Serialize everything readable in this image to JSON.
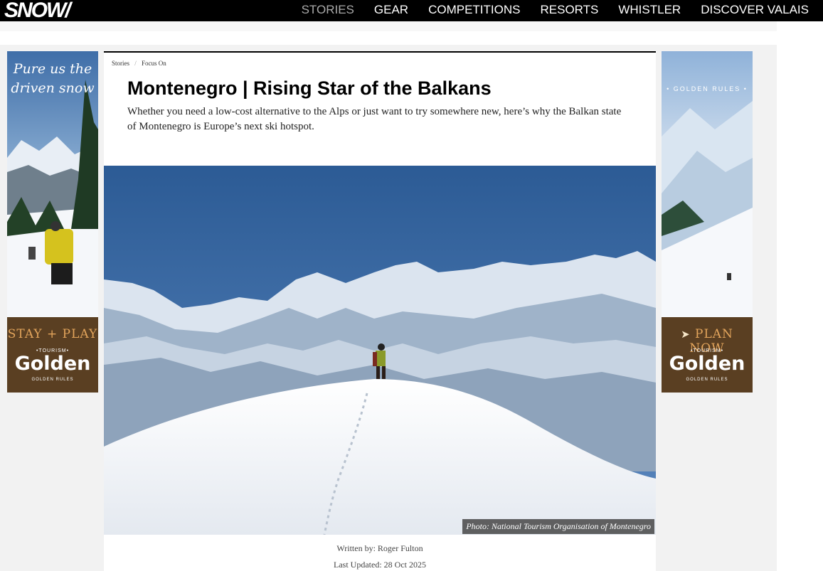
{
  "header": {
    "logo": "SNOW/",
    "nav": [
      {
        "label": "STORIES",
        "active": true
      },
      {
        "label": "GEAR",
        "active": false
      },
      {
        "label": "COMPETITIONS",
        "active": false
      },
      {
        "label": "RESORTS",
        "active": false
      },
      {
        "label": "WHISTLER",
        "active": false
      },
      {
        "label": "DISCOVER VALAIS",
        "active": false
      }
    ]
  },
  "ads": {
    "left": {
      "headline": "Pure us the driven snow",
      "cta": "STAY + PLAY",
      "tourism": "•TOURISM•",
      "brand": "Golden",
      "brand_sub": "GOLDEN RULES"
    },
    "right": {
      "headline": "• GOLDEN RULES •",
      "cta": "PLAN NOW",
      "tourism": "•TOURISM•",
      "brand": "Golden",
      "brand_sub": "GOLDEN RULES"
    }
  },
  "article": {
    "breadcrumb": [
      "Stories",
      "Focus On"
    ],
    "breadcrumb_separator": "/",
    "title": "Montenegro | Rising Star of the Balkans",
    "lede": "Whether you need a low-cost alternative to the Alps or just want to try somewhere new, here’s why the Balkan state of Montenegro is Europe’s next ski hotspot.",
    "photo_caption": "Photo: National Tourism Organisation of Montenegro",
    "byline": "Written by: Roger Fulton",
    "updated": "Last Updated: 28 Oct 2025"
  },
  "colors": {
    "nav_bg": "#000000",
    "nav_active": "#aaaaaa",
    "ad_brand_bg": "#5a3f22",
    "ad_cta": "#e3a55c",
    "sky": "#2c5b95"
  },
  "icons": [
    "cursor-arrow-icon"
  ]
}
